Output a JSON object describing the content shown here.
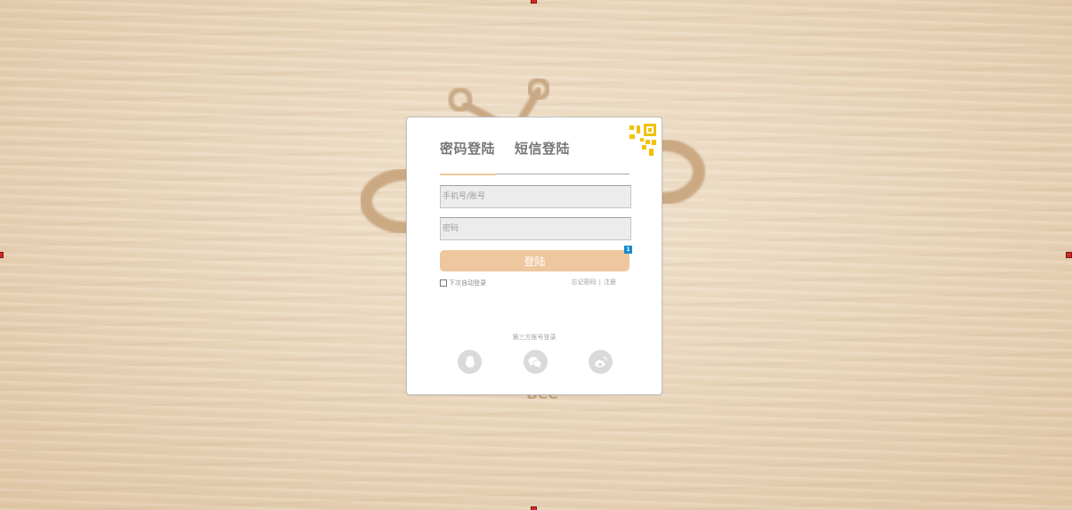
{
  "login": {
    "tabs": [
      {
        "label": "密码登陆",
        "active": true
      },
      {
        "label": "短信登陆",
        "active": false
      }
    ],
    "account_placeholder": "手机号/账号",
    "password_placeholder": "密码",
    "login_button": "登陆",
    "badge": "1",
    "remember_label": "下次自动登录",
    "forgot_label": "忘记密码",
    "register_label": "注册",
    "separator": "|",
    "third_party_label": "第三方账号登录",
    "social_icons": [
      "qq-icon",
      "wechat-icon",
      "weibo-icon"
    ],
    "qr_icon": "qr-code-icon"
  },
  "colors": {
    "accent": "#efc79f",
    "qr": "#f2c200",
    "badge": "#1a8bd0",
    "social_bg": "#dadada"
  }
}
